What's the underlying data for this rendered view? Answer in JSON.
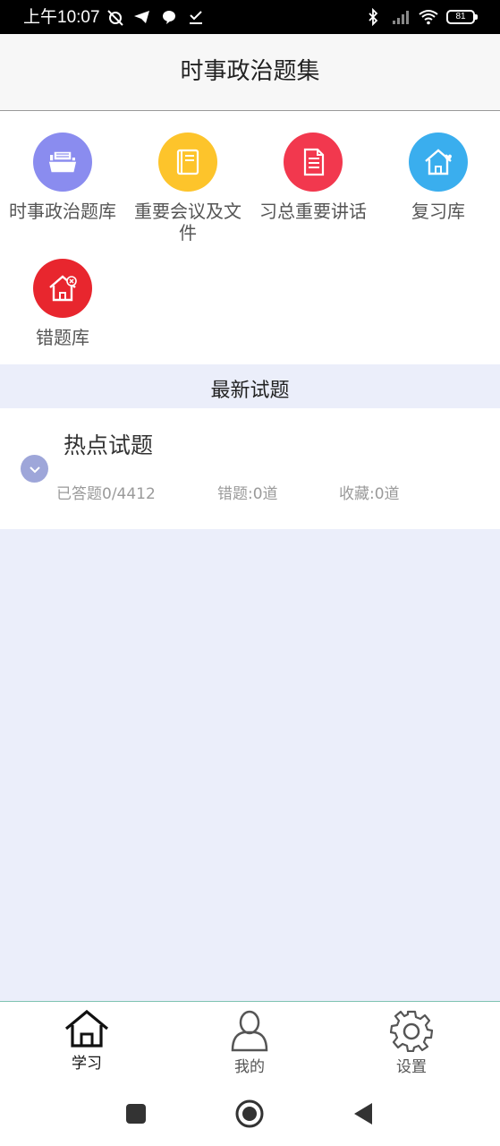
{
  "status_bar": {
    "time": "上午10:07",
    "battery": "81"
  },
  "header": {
    "title": "时事政治题集"
  },
  "categories": [
    {
      "label": "时事政治题库",
      "icon": "folder-icon",
      "color": "#8a8cef"
    },
    {
      "label": "重要会议及文件",
      "icon": "book-icon",
      "color": "#fdc42b"
    },
    {
      "label": "习总重要讲话",
      "icon": "document-icon",
      "color": "#f2384e"
    },
    {
      "label": "复习库",
      "icon": "home-heart-icon",
      "color": "#3aaeee"
    },
    {
      "label": "错题库",
      "icon": "home-x-icon",
      "color": "#e8262e"
    }
  ],
  "section": {
    "title": "最新试题"
  },
  "exam": {
    "name": "热点试题",
    "answered": "已答题0/4412",
    "wrong": "错题:0道",
    "favorites": "收藏:0道"
  },
  "tabs": [
    {
      "label": "学习",
      "icon": "home-icon",
      "active": true
    },
    {
      "label": "我的",
      "icon": "user-icon",
      "active": false
    },
    {
      "label": "设置",
      "icon": "gear-icon",
      "active": false
    }
  ],
  "colors": {
    "accent_bg": "#ebeefa",
    "tab_active": "#111111",
    "tab_inactive": "#555555"
  }
}
